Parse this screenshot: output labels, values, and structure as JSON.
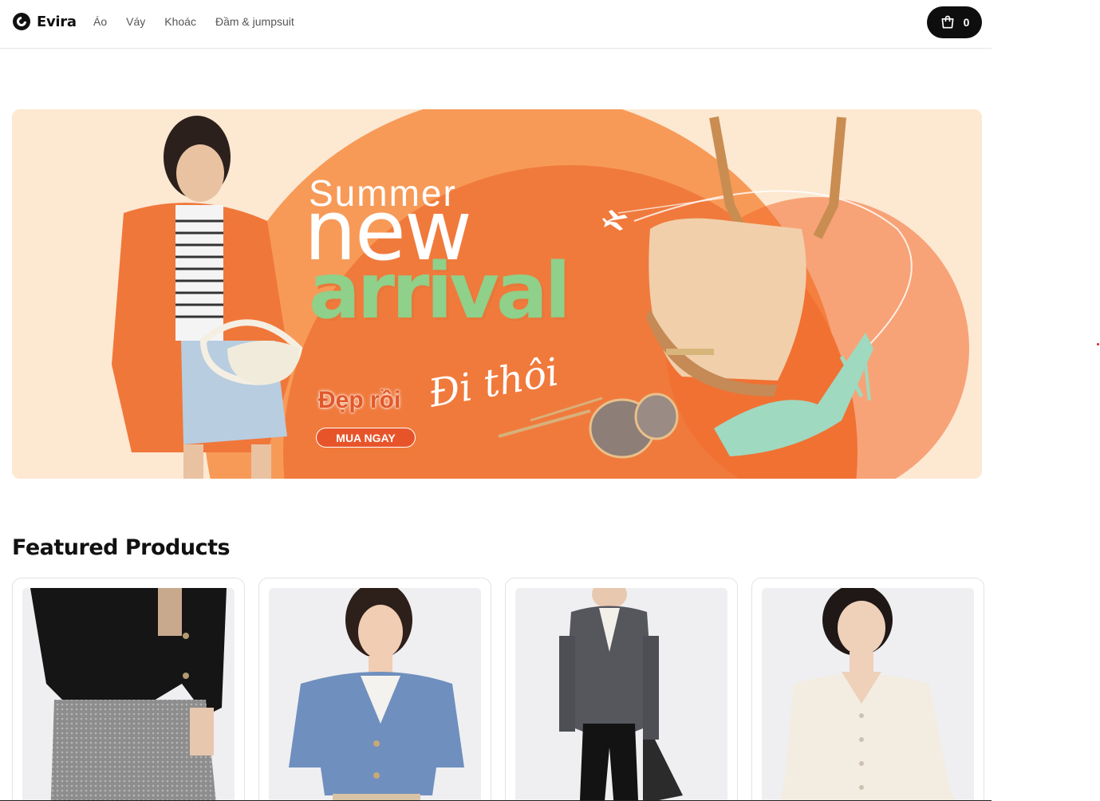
{
  "header": {
    "brand": "Evira",
    "nav": [
      {
        "label": "Áo"
      },
      {
        "label": "Váy"
      },
      {
        "label": "Khoác"
      },
      {
        "label": "Đầm & jumpsuit"
      }
    ],
    "cart_count": "0"
  },
  "banner": {
    "line1": "Summer",
    "line2": "new",
    "line3": "arrival",
    "tagline": "Đẹp rồi",
    "script": "Đi thôi",
    "cta": "MUA NGAY"
  },
  "featured": {
    "title": "Featured Products",
    "products": [
      {
        "image": "black cropped blazer with grey tweed skirt"
      },
      {
        "image": "blue short-sleeve cropped blazer"
      },
      {
        "image": "grey long blazer with black trousers"
      },
      {
        "image": "cream long-sleeve shirt"
      }
    ]
  },
  "colors": {
    "banner_orange": "#f07a3c",
    "banner_green": "#8fd08a",
    "cart_bg": "#0e0e0e"
  }
}
